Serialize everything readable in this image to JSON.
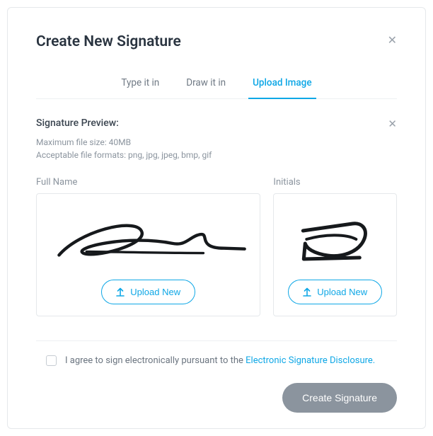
{
  "modal": {
    "title": "Create New Signature"
  },
  "tabs": {
    "type": "Type it in",
    "draw": "Draw it in",
    "upload": "Upload Image",
    "active": "upload"
  },
  "preview": {
    "label": "Signature Preview:",
    "max_size": "Maximum file size: 40MB",
    "formats": "Acceptable file formats: png, jpg, jpeg, bmp, gif"
  },
  "signature": {
    "full_label": "Full Name",
    "initials_label": "Initials",
    "upload_button": "Upload New"
  },
  "consent": {
    "text_prefix": "I agree to sign electronically pursuant to the ",
    "link_text": "Electronic Signature Disclosure.",
    "checked": false
  },
  "footer": {
    "create_button": "Create Signature"
  },
  "colors": {
    "accent": "#0ea7e6",
    "muted": "#8b949e"
  }
}
